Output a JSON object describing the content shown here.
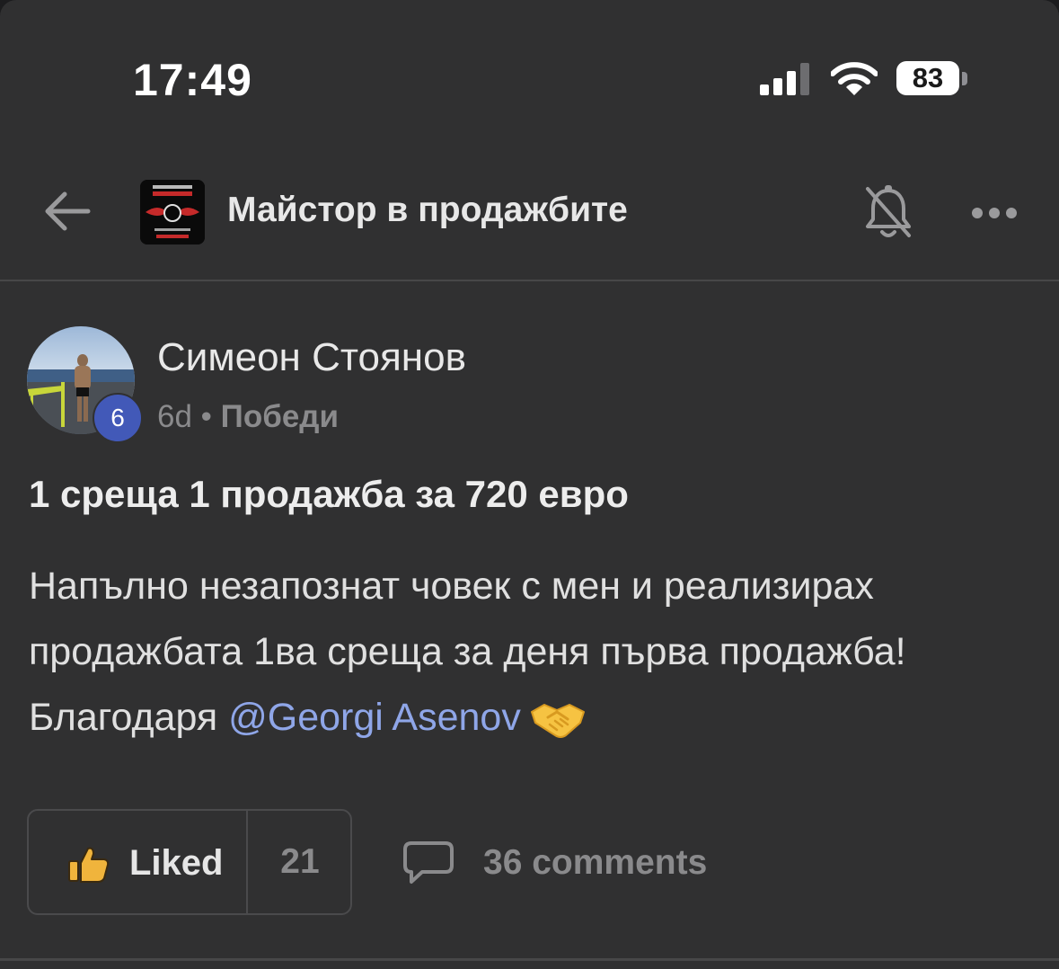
{
  "status_bar": {
    "time": "17:49",
    "battery": "83",
    "icons": [
      "cellular-signal-icon",
      "wifi-icon",
      "battery-icon"
    ]
  },
  "header": {
    "back_icon": "arrow-left-icon",
    "group_name": "Майстор в продажбите",
    "bell_icon": "bell-muted-icon",
    "more_icon": "more-horizontal-icon"
  },
  "post": {
    "author": {
      "name": "Симеон Стоянов",
      "level": "6"
    },
    "time": "6d",
    "separator": "•",
    "category": "Победи",
    "title": "1 среща 1 продажба за 720 евро",
    "body_line_1": "Напълно незапознат човек с мен и реализирах",
    "body_line_2": "продажбата 1ва среща за деня първа продажба!",
    "body_line_3_prefix": "Благодаря ",
    "mention": "@Georgi Asenov",
    "emoji_name": "handshake-emoji"
  },
  "actions": {
    "like_label": "Liked",
    "like_count": "21",
    "comments_label": "36 comments",
    "like_icon": "thumbs-up-icon",
    "comment_icon": "comment-bubble-icon"
  },
  "colors": {
    "background": "#303031",
    "mention": "#8fa6e8",
    "level_badge": "#4259b8",
    "muted_text": "#8a8a8c",
    "liked_thumb": "#f0b43c"
  }
}
